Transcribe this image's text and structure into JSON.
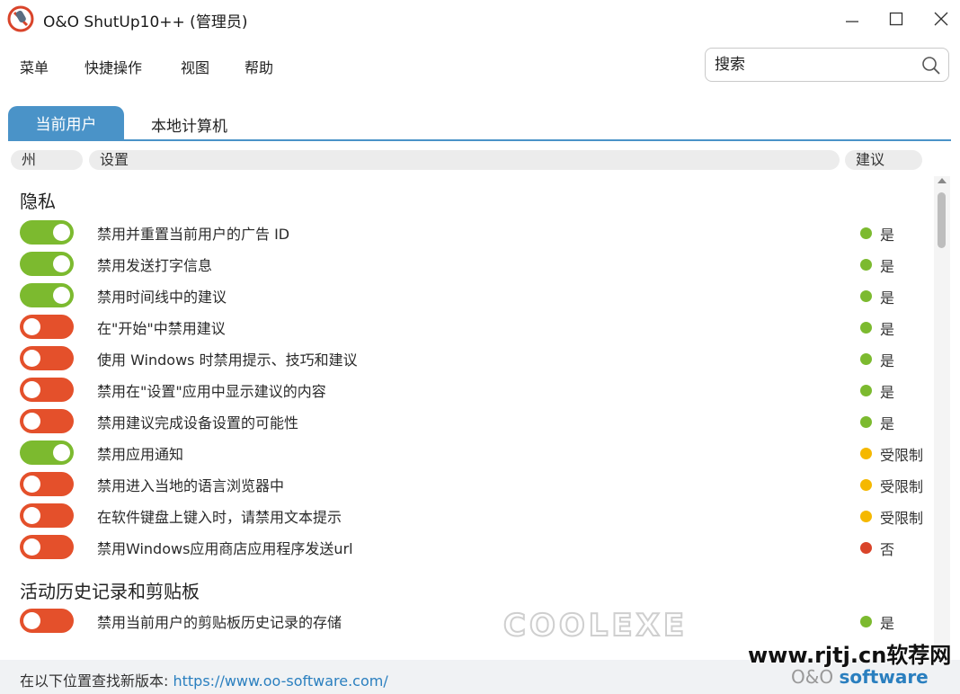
{
  "window": {
    "title": "O&O ShutUp10++ (管理员)"
  },
  "menu": {
    "items": [
      "菜单",
      "快捷操作",
      "视图",
      "帮助"
    ]
  },
  "search": {
    "value": "",
    "placeholder": "搜索"
  },
  "tabs": {
    "current_user": "当前用户",
    "local_computer": "本地计算机"
  },
  "columns": {
    "state": "州",
    "setting": "设置",
    "recommendation": "建议"
  },
  "sections": [
    {
      "title": "隐私"
    },
    {
      "title": "活动历史记录和剪贴板"
    }
  ],
  "settings": [
    {
      "label": "禁用并重置当前用户的广告 ID",
      "enabled": true,
      "recommendation": "是",
      "level": "yes"
    },
    {
      "label": "禁用发送打字信息",
      "enabled": true,
      "recommendation": "是",
      "level": "yes"
    },
    {
      "label": "禁用时间线中的建议",
      "enabled": true,
      "recommendation": "是",
      "level": "yes"
    },
    {
      "label": "在\"开始\"中禁用建议",
      "enabled": false,
      "recommendation": "是",
      "level": "yes"
    },
    {
      "label": "使用 Windows 时禁用提示、技巧和建议",
      "enabled": false,
      "recommendation": "是",
      "level": "yes"
    },
    {
      "label": "禁用在\"设置\"应用中显示建议的内容",
      "enabled": false,
      "recommendation": "是",
      "level": "yes"
    },
    {
      "label": "禁用建议完成设备设置的可能性",
      "enabled": false,
      "recommendation": "是",
      "level": "yes"
    },
    {
      "label": "禁用应用通知",
      "enabled": true,
      "recommendation": "受限制",
      "level": "limited"
    },
    {
      "label": "禁用进入当地的语言浏览器中",
      "enabled": false,
      "recommendation": "受限制",
      "level": "limited"
    },
    {
      "label": "在软件键盘上键入时，请禁用文本提示",
      "enabled": false,
      "recommendation": "受限制",
      "level": "limited"
    },
    {
      "label": "禁用Windows应用商店应用程序发送url",
      "enabled": false,
      "recommendation": "否",
      "level": "no"
    },
    {
      "label": "禁用当前用户的剪贴板历史记录的存储",
      "enabled": false,
      "recommendation": "是",
      "level": "yes"
    }
  ],
  "colors": {
    "on": "#7cba2f",
    "off": "#e4502b",
    "yes": "#7cba2f",
    "limited": "#f5b800",
    "no": "#d9442a",
    "accent": "#4a93c8"
  },
  "icons": {
    "app": "shield-logo-icon",
    "search": "search-icon",
    "minimize": "minimize-icon",
    "maximize": "maximize-icon",
    "close": "close-icon"
  },
  "footer": {
    "text": "在以下位置查找新版本: ",
    "link": "https://www.oo-software.com/"
  },
  "watermarks": {
    "coolexe": "COOLEXE",
    "site": "www.rjtj.cn软荐网",
    "brand_prefix": "O&O ",
    "brand_main": "software"
  }
}
